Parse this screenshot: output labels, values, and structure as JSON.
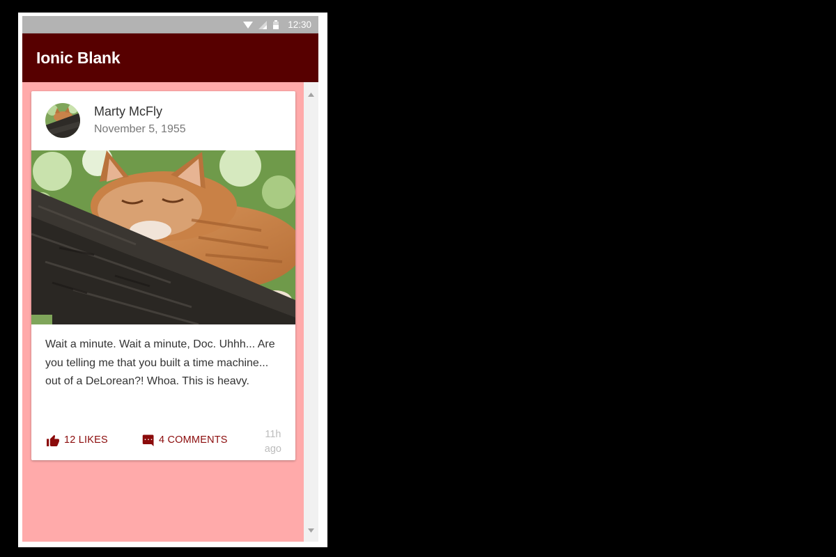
{
  "status_bar": {
    "time": "12:30",
    "icons": [
      "wifi-icon",
      "signal-icon",
      "battery-icon"
    ]
  },
  "toolbar": {
    "title": "Ionic Blank",
    "color": "#570000"
  },
  "content": {
    "background": "#ffaaaa"
  },
  "card": {
    "author": "Marty McFly",
    "date": "November 5, 1955",
    "image": "cat-on-tree-branch",
    "text": "Wait a minute. Wait a minute, Doc. Uhhh... Are you telling me that you built a time machine... out of a DeLorean?! Whoa. This is heavy.",
    "likes_label": "12 LIKES",
    "comments_label": "4 COMMENTS",
    "time_value": "11h",
    "time_suffix": "ago",
    "accent": "#8b0b0b"
  }
}
